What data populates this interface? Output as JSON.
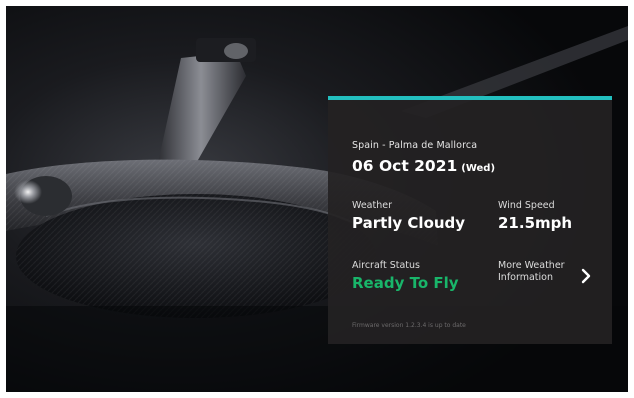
{
  "panel": {
    "location": "Spain - Palma de Mallorca",
    "date": "06 Oct 2021",
    "day": "(Wed)",
    "weather_label": "Weather",
    "weather_value": "Partly Cloudy",
    "wind_label": "Wind Speed",
    "wind_value": "21.5mph",
    "status_label": "Aircraft Status",
    "status_value": "Ready To Fly",
    "more_weather_label": "More Weather Information",
    "more_weather_icon": "chevron-right-icon",
    "firmware_text": "Firmware version 1.2.3.4 is up to date"
  },
  "colors": {
    "accent": "#23bfbf",
    "status_ready": "#19b56a",
    "panel_bg": "#242223",
    "text_primary": "#ffffff",
    "text_secondary": "#dcdcdc",
    "text_muted": "#6c6a6b"
  }
}
